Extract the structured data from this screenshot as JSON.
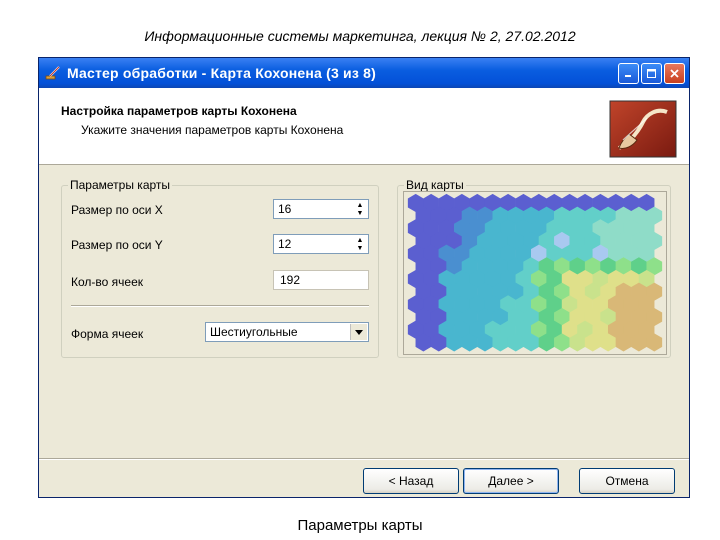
{
  "slide": {
    "title": "Информационные системы маркетинга, лекция № 2, 27.02.2012",
    "caption": "Параметры карты"
  },
  "window": {
    "title": "Мастер обработки - Карта Кохонена (3 из 8)",
    "icons": [
      "wizard-icon",
      "minimize-icon",
      "maximize-icon",
      "close-icon"
    ]
  },
  "header": {
    "title": "Настройка параметров карты Кохонена",
    "subtitle": "Укажите значения параметров карты Кохонена",
    "logo": "pipe-logo"
  },
  "params": {
    "group_label": "Параметры карты",
    "size_x_label": "Размер по оси X",
    "size_x_value": "16",
    "size_y_label": "Размер по оси Y",
    "size_y_value": "12",
    "cells_label": "Кол-во ячеек",
    "cells_value": "192",
    "shape_label": "Форма ячеек",
    "shape_value": "Шестиугольные"
  },
  "preview": {
    "group_label": "Вид карты",
    "cols": 16,
    "rows": 12,
    "palette": [
      "#5b5fd0",
      "#4a8fd0",
      "#49b6cf",
      "#62cfc9",
      "#8fdcc8",
      "#a9c9f0",
      "#5fd08a",
      "#8ee08a",
      "#c9e28c",
      "#dfe08a",
      "#d9b877"
    ]
  },
  "buttons": {
    "back": "< Назад",
    "next": "Далее >",
    "cancel": "Отмена"
  }
}
